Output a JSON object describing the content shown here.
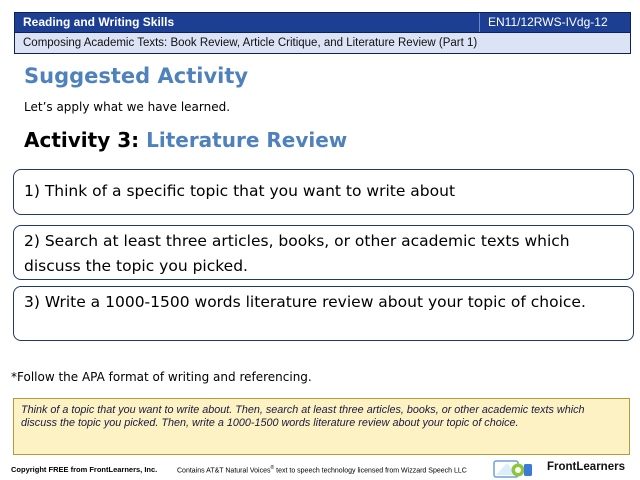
{
  "header": {
    "subject": "Reading and Writing Skills",
    "code": "EN11/12RWS-IVdg-12",
    "lesson": "Composing Academic Texts: Book Review, Article Critique, and Literature Review (Part 1)"
  },
  "main": {
    "section_title": "Suggested Activity",
    "intro": "Let’s apply what we have learned.",
    "activity_prefix": "Activity 3: ",
    "activity_name": "Literature Review",
    "steps": [
      "1) Think of a specific topic that you want to write about",
      "2) Search at least three articles, books, or other academic texts which discuss the topic you picked.",
      "3) Write a 1000-1500 words literature review about your topic of choice."
    ],
    "note": "*Follow the APA format of writing and referencing."
  },
  "summary_box": {
    "text": "Think of a topic that you want to write about. Then, search at least three articles, books, or other academic texts which discuss the topic you picked. Then, write a 1000-1500 words literature review about your topic of choice."
  },
  "footer": {
    "copyright": "Copyright FREE from FrontLearners, Inc.",
    "voices_pre": "Contains AT&T Natural Voices",
    "voices_reg": "®",
    "voices_post": " text to speech technology licensed from Wizzard Speech LLC",
    "brand": "FrontLearners"
  },
  "colors": {
    "header_bg": "#1c3f94",
    "subheader_bg": "#dbe3f4",
    "accent_blue": "#4f81bd",
    "summary_bg": "#fdf2c4",
    "step_border": "#1f3a6e"
  },
  "icons": {
    "logo": "frontlearners-logo-icon"
  }
}
